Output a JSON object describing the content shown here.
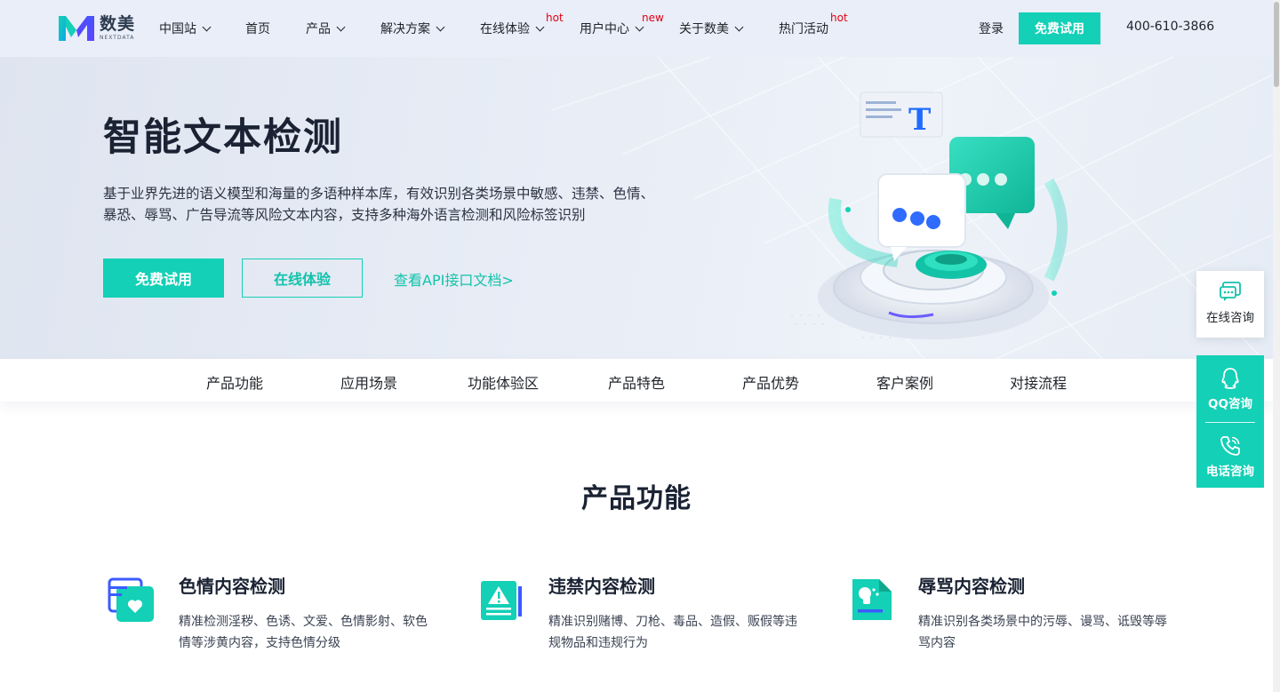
{
  "brand": {
    "name_cn": "数美",
    "name_en": "NEXTDATA"
  },
  "header": {
    "nav": [
      {
        "label": "中国站",
        "dropdown": true
      },
      {
        "label": "首页",
        "dropdown": false
      },
      {
        "label": "产品",
        "dropdown": true
      },
      {
        "label": "解决方案",
        "dropdown": true
      },
      {
        "label": "在线体验",
        "dropdown": true,
        "badge": "hot"
      },
      {
        "label": "用户中心",
        "dropdown": true,
        "badge": "new"
      },
      {
        "label": "关于数美",
        "dropdown": true
      },
      {
        "label": "热门活动",
        "dropdown": false,
        "badge": "hot"
      }
    ],
    "login": "登录",
    "trial": "免费试用",
    "phone": "400-610-3866"
  },
  "hero": {
    "title": "智能文本检测",
    "description": "基于业界先进的语义模型和海量的多语种样本库，有效识别各类场景中敏感、违禁、色情、暴恐、辱骂、广告导流等风险文本内容，支持多种海外语言检测和风险标签识别",
    "primary_button": "免费试用",
    "secondary_button": "在线体验",
    "api_link": "查看API接口文档>"
  },
  "subnav": [
    "产品功能",
    "应用场景",
    "功能体验区",
    "产品特色",
    "产品优势",
    "客户案例",
    "对接流程"
  ],
  "features_section": {
    "title": "产品功能",
    "items": [
      {
        "title": "色情内容检测",
        "desc": "精准检测淫秽、色诱、文爱、色情影射、软色情等涉黄内容，支持色情分级",
        "icon": "heart-document-icon"
      },
      {
        "title": "违禁内容检测",
        "desc": "精准识别赌博、刀枪、毒品、造假、贩假等违规物品和违规行为",
        "icon": "warning-document-icon"
      },
      {
        "title": "辱骂内容检测",
        "desc": "精准识别各类场景中的污辱、谩骂、诋毁等辱骂内容",
        "icon": "abuse-document-icon"
      }
    ]
  },
  "floating": {
    "online": "在线咨询",
    "qq": "QQ咨询",
    "phone": "电话咨询"
  },
  "colors": {
    "accent": "#13d0b6",
    "header_bg": "#e9eef8",
    "hot_badge": "#e60012",
    "text_dark": "#1a2233"
  }
}
